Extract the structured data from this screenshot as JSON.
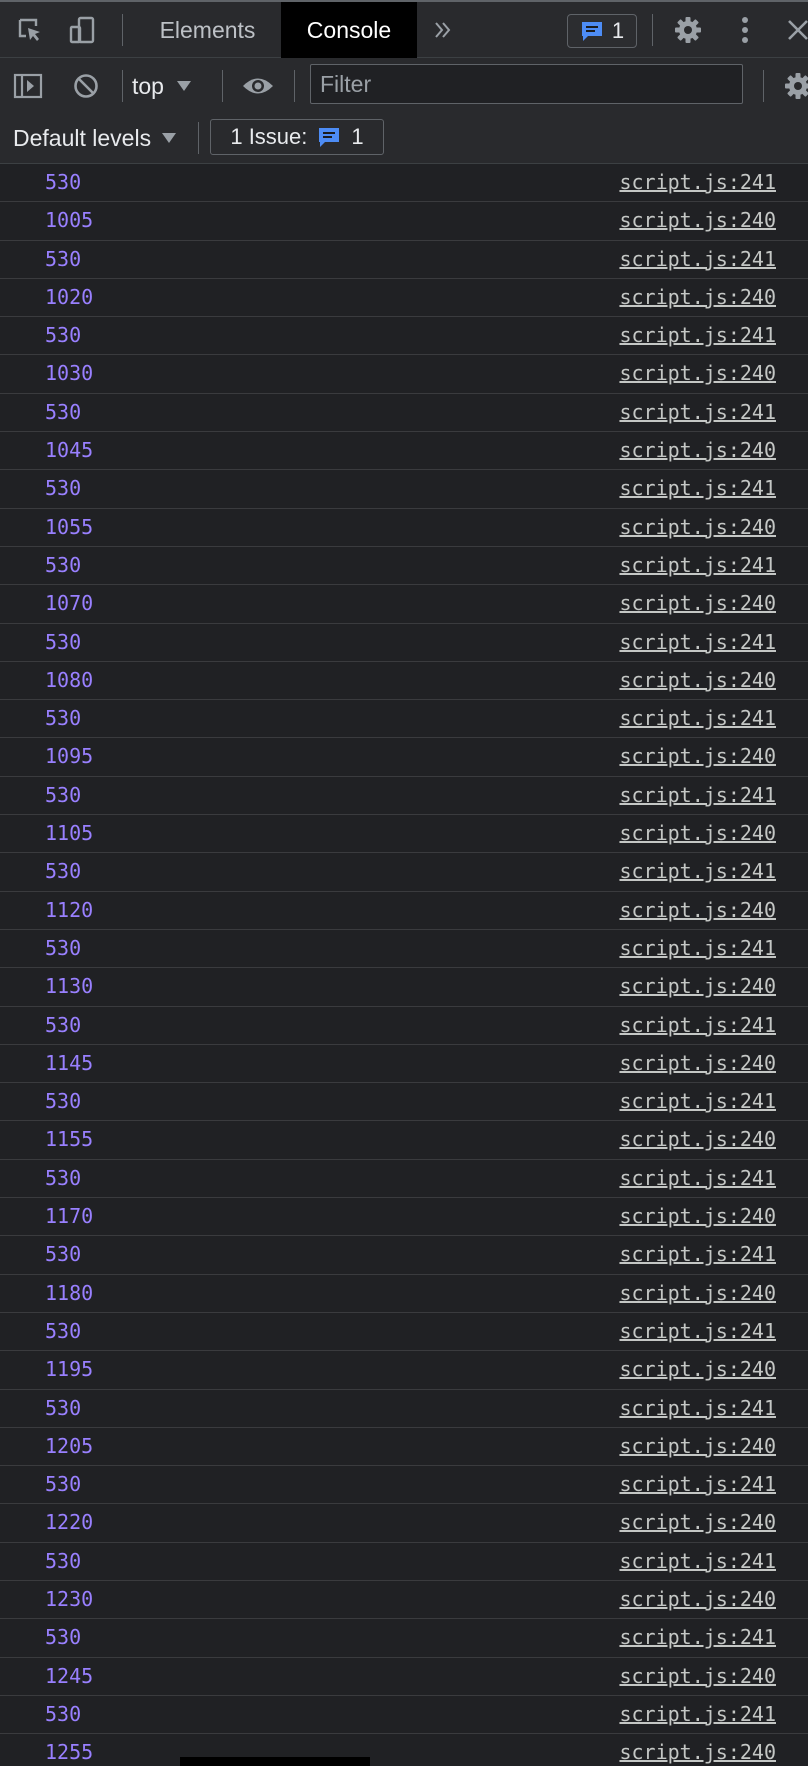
{
  "tabs": [
    {
      "label": "Elements",
      "active": false
    },
    {
      "label": "Console",
      "active": true
    }
  ],
  "issues_badge": {
    "count": "1"
  },
  "context": {
    "value": "top"
  },
  "filter": {
    "placeholder": "Filter"
  },
  "levels": {
    "label": "Default levels"
  },
  "issues_button": {
    "label": "1 Issue:",
    "count": "1"
  },
  "colors": {
    "log_value": "#9980ff",
    "source_link": "#c4c7c5",
    "accent_badge": "#4d8cf5"
  },
  "log": [
    {
      "value": "530",
      "source": "script.js:241"
    },
    {
      "value": "1005",
      "source": "script.js:240"
    },
    {
      "value": "530",
      "source": "script.js:241"
    },
    {
      "value": "1020",
      "source": "script.js:240"
    },
    {
      "value": "530",
      "source": "script.js:241"
    },
    {
      "value": "1030",
      "source": "script.js:240"
    },
    {
      "value": "530",
      "source": "script.js:241"
    },
    {
      "value": "1045",
      "source": "script.js:240"
    },
    {
      "value": "530",
      "source": "script.js:241"
    },
    {
      "value": "1055",
      "source": "script.js:240"
    },
    {
      "value": "530",
      "source": "script.js:241"
    },
    {
      "value": "1070",
      "source": "script.js:240"
    },
    {
      "value": "530",
      "source": "script.js:241"
    },
    {
      "value": "1080",
      "source": "script.js:240"
    },
    {
      "value": "530",
      "source": "script.js:241"
    },
    {
      "value": "1095",
      "source": "script.js:240"
    },
    {
      "value": "530",
      "source": "script.js:241"
    },
    {
      "value": "1105",
      "source": "script.js:240"
    },
    {
      "value": "530",
      "source": "script.js:241"
    },
    {
      "value": "1120",
      "source": "script.js:240"
    },
    {
      "value": "530",
      "source": "script.js:241"
    },
    {
      "value": "1130",
      "source": "script.js:240"
    },
    {
      "value": "530",
      "source": "script.js:241"
    },
    {
      "value": "1145",
      "source": "script.js:240"
    },
    {
      "value": "530",
      "source": "script.js:241"
    },
    {
      "value": "1155",
      "source": "script.js:240"
    },
    {
      "value": "530",
      "source": "script.js:241"
    },
    {
      "value": "1170",
      "source": "script.js:240"
    },
    {
      "value": "530",
      "source": "script.js:241"
    },
    {
      "value": "1180",
      "source": "script.js:240"
    },
    {
      "value": "530",
      "source": "script.js:241"
    },
    {
      "value": "1195",
      "source": "script.js:240"
    },
    {
      "value": "530",
      "source": "script.js:241"
    },
    {
      "value": "1205",
      "source": "script.js:240"
    },
    {
      "value": "530",
      "source": "script.js:241"
    },
    {
      "value": "1220",
      "source": "script.js:240"
    },
    {
      "value": "530",
      "source": "script.js:241"
    },
    {
      "value": "1230",
      "source": "script.js:240"
    },
    {
      "value": "530",
      "source": "script.js:241"
    },
    {
      "value": "1245",
      "source": "script.js:240"
    },
    {
      "value": "530",
      "source": "script.js:241"
    },
    {
      "value": "1255",
      "source": "script.js:240"
    }
  ]
}
